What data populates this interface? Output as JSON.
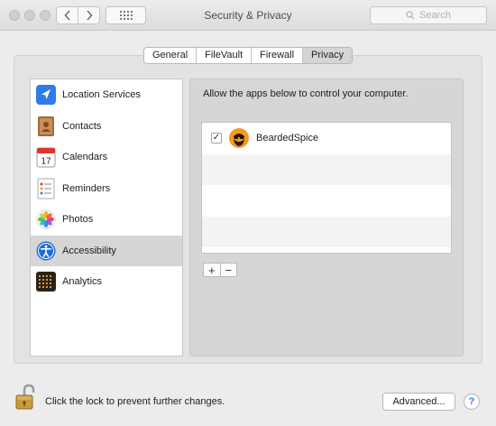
{
  "window": {
    "title": "Security & Privacy",
    "search_placeholder": "Search",
    "back_icon": "chevron-left-icon",
    "forward_icon": "chevron-right-icon",
    "grid_icon": "show-all-grid-icon"
  },
  "tabs": [
    {
      "label": "General",
      "active": false
    },
    {
      "label": "FileVault",
      "active": false
    },
    {
      "label": "Firewall",
      "active": false
    },
    {
      "label": "Privacy",
      "active": true
    }
  ],
  "sidebar": {
    "items": [
      {
        "label": "Location Services",
        "icon": "location-arrow-icon",
        "selected": false
      },
      {
        "label": "Contacts",
        "icon": "contacts-book-icon",
        "selected": false
      },
      {
        "label": "Calendars",
        "icon": "calendar-icon",
        "selected": false,
        "icon_text": "17"
      },
      {
        "label": "Reminders",
        "icon": "reminders-list-icon",
        "selected": false
      },
      {
        "label": "Photos",
        "icon": "photos-flower-icon",
        "selected": false
      },
      {
        "label": "Accessibility",
        "icon": "accessibility-person-icon",
        "selected": true
      },
      {
        "label": "Analytics",
        "icon": "analytics-grid-icon",
        "selected": false
      }
    ]
  },
  "content": {
    "heading": "Allow the apps below to control your computer.",
    "apps": [
      {
        "name": "BeardedSpice",
        "checked": true,
        "check_mark": "✓",
        "icon": "beardedspice-app-icon"
      }
    ],
    "add_label": "+",
    "remove_label": "−"
  },
  "footer": {
    "lock_text": "Click the lock to prevent further changes.",
    "lock_icon": "padlock-open-icon",
    "advanced_label": "Advanced...",
    "help_label": "?"
  },
  "colors": {
    "accessibility_blue": "#1d6fd8",
    "bearded_orange": "#f39a1e",
    "help_blue": "#3c7de0"
  }
}
